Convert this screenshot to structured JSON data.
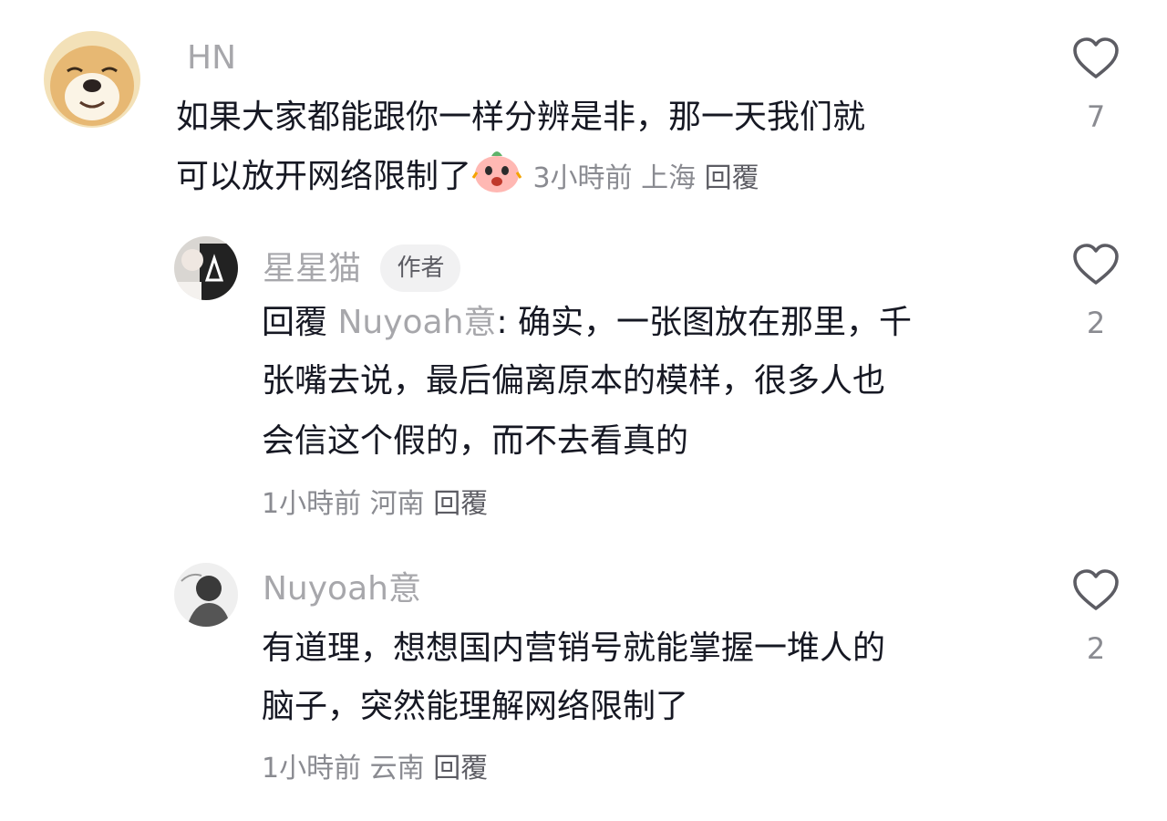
{
  "comments": [
    {
      "user": "HN",
      "lines": [
        "如果大家都能跟你一样分辨是非，那一天我们就",
        "可以放开网络限制了"
      ],
      "sticker_icon": "crying-face-sticker-icon",
      "time": "3小時前",
      "location": "上海",
      "reply_label": "回覆",
      "likes": "7"
    },
    {
      "user": "星星猫",
      "badge": "作者",
      "reply_prefix": "回覆",
      "mention": "Nuyoah意",
      "line1_rest": ": 确实，一张图放在那里，千",
      "lines": [
        "张嘴去说，最后偏离原本的模样，很多人也",
        "会信这个假的，而不去看真的"
      ],
      "time": "1小時前",
      "location": "河南",
      "reply_label": "回覆",
      "likes": "2"
    },
    {
      "user": "Nuyoah意",
      "lines": [
        "有道理，想想国内营销号就能掌握一堆人的",
        "脑子，突然能理解网络限制了"
      ],
      "time": "1小時前",
      "location": "云南",
      "reply_label": "回覆",
      "likes": "2"
    }
  ],
  "icons": {
    "like": "heart-outline-icon"
  },
  "colors": {
    "name": "#a7a7ab",
    "text": "#161823",
    "meta": "#8a8b91"
  }
}
